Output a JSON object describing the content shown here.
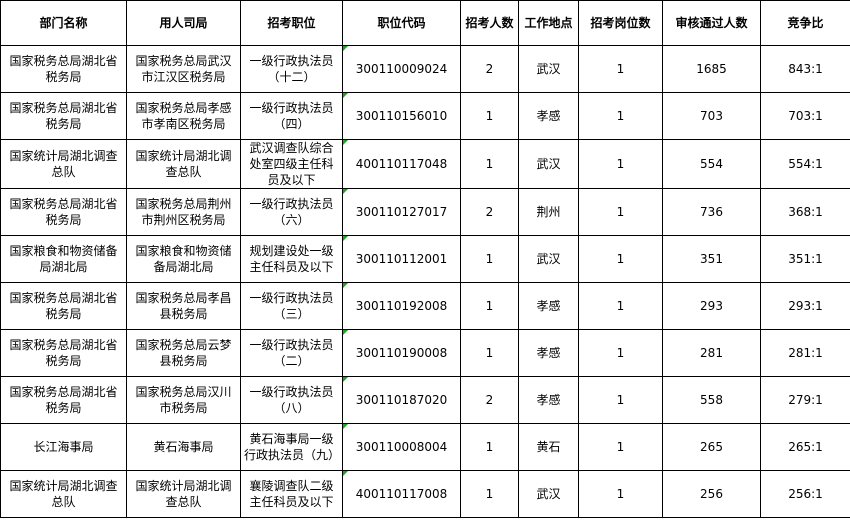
{
  "headers": [
    "部门名称",
    "用人司局",
    "招考职位",
    "职位代码",
    "招考人数",
    "工作地点",
    "招考岗位数",
    "审核通过人数",
    "竞争比"
  ],
  "rows": [
    [
      "国家税务总局湖北省税务局",
      "国家税务总局武汉市江汉区税务局",
      "一级行政执法员（十二）",
      "300110009024",
      "2",
      "武汉",
      "1",
      "1685",
      "843:1"
    ],
    [
      "国家税务总局湖北省税务局",
      "国家税务总局孝感市孝南区税务局",
      "一级行政执法员（四）",
      "300110156010",
      "1",
      "孝感",
      "1",
      "703",
      "703:1"
    ],
    [
      "国家统计局湖北调查总队",
      "国家统计局湖北调查总队",
      "武汉调查队综合处室四级主任科员及以下",
      "400110117048",
      "1",
      "武汉",
      "1",
      "554",
      "554:1"
    ],
    [
      "国家税务总局湖北省税务局",
      "国家税务总局荆州市荆州区税务局",
      "一级行政执法员（六）",
      "300110127017",
      "2",
      "荆州",
      "1",
      "736",
      "368:1"
    ],
    [
      "国家粮食和物资储备局湖北局",
      "国家粮食和物资储备局湖北局",
      "规划建设处一级主任科员及以下",
      "300110112001",
      "1",
      "武汉",
      "1",
      "351",
      "351:1"
    ],
    [
      "国家税务总局湖北省税务局",
      "国家税务总局孝昌县税务局",
      "一级行政执法员（三）",
      "300110192008",
      "1",
      "孝感",
      "1",
      "293",
      "293:1"
    ],
    [
      "国家税务总局湖北省税务局",
      "国家税务总局云梦县税务局",
      "一级行政执法员（二）",
      "300110190008",
      "1",
      "孝感",
      "1",
      "281",
      "281:1"
    ],
    [
      "国家税务总局湖北省税务局",
      "国家税务总局汉川市税务局",
      "一级行政执法员（八）",
      "300110187020",
      "2",
      "孝感",
      "1",
      "558",
      "279:1"
    ],
    [
      "长江海事局",
      "黄石海事局",
      "黄石海事局一级行政执法员（九）",
      "300110008004",
      "1",
      "黄石",
      "1",
      "265",
      "265:1"
    ],
    [
      "国家统计局湖北调查总队",
      "国家统计局湖北调查总队",
      "襄陵调查队二级主任科员及以下",
      "400110117008",
      "1",
      "武汉",
      "1",
      "256",
      "256:1"
    ]
  ]
}
